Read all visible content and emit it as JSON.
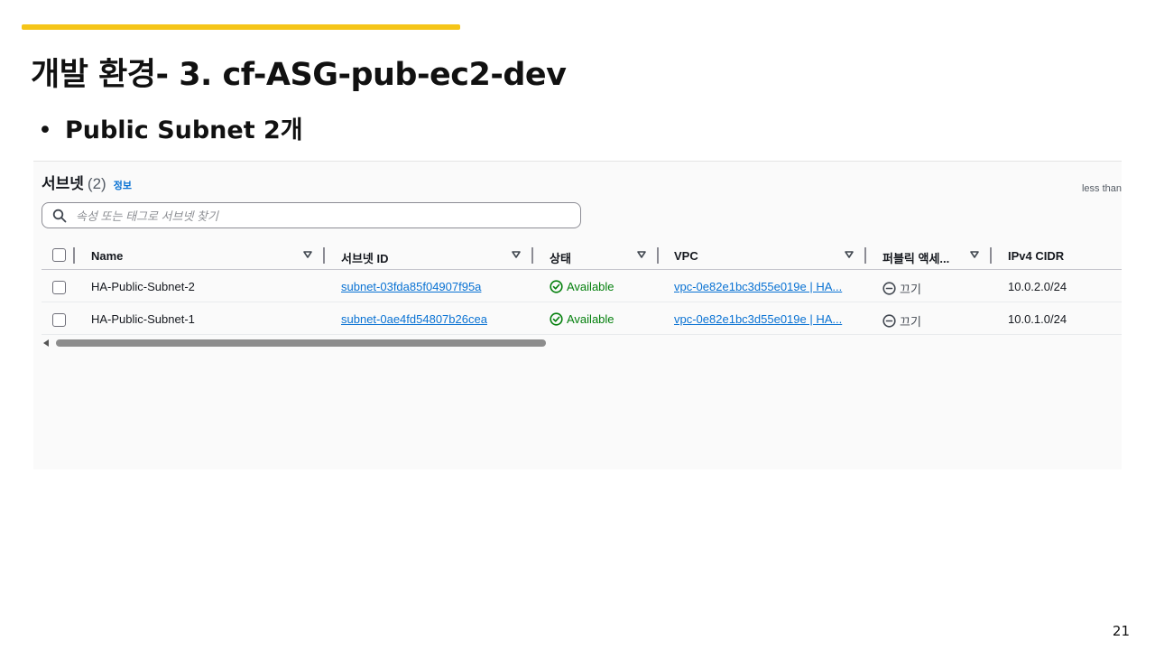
{
  "slide": {
    "title": "개발 환경- 3. cf-ASG-pub-ec2-dev",
    "bullet": "Public Subnet 2개",
    "bullet_marker": "•",
    "page_number": "21",
    "accent_color": "#f5c518"
  },
  "console": {
    "title": "서브넷",
    "count": "(2)",
    "info_link": "정보",
    "truncated_text": "less than",
    "search": {
      "placeholder": "속성 또는 태그로 서브넷 찾기",
      "icon": "search-icon"
    },
    "columns": [
      "Name",
      "서브넷 ID",
      "상태",
      "VPC",
      "퍼블릭 액세...",
      "IPv4 CIDR"
    ],
    "rows": [
      {
        "name": "HA-Public-Subnet-2",
        "subnet_id": "subnet-03fda85f04907f95a",
        "status": "Available",
        "vpc": "vpc-0e82e1bc3d55e019e | HA...",
        "public_access": "끄기",
        "ipv4_cidr": "10.0.2.0/24"
      },
      {
        "name": "HA-Public-Subnet-1",
        "subnet_id": "subnet-0ae4fd54807b26cea",
        "status": "Available",
        "vpc": "vpc-0e82e1bc3d55e019e | HA...",
        "public_access": "끄기",
        "ipv4_cidr": "10.0.1.0/24"
      }
    ],
    "colors": {
      "link": "#0972d3",
      "available": "#037f0c"
    }
  }
}
